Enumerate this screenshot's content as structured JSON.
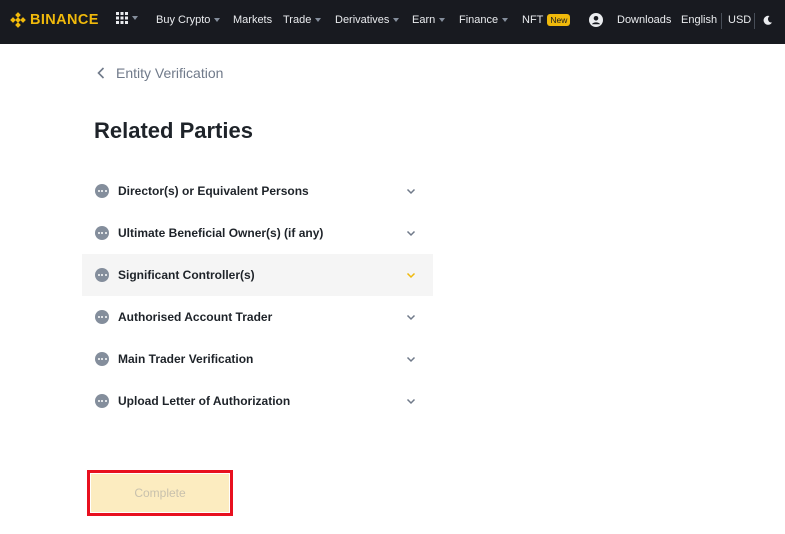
{
  "brand": {
    "name": "BINANCE",
    "color": "#f0b90b"
  },
  "nav": {
    "items": [
      {
        "label": "Buy Crypto",
        "caret": true
      },
      {
        "label": "Markets",
        "caret": false
      },
      {
        "label": "Trade",
        "caret": true
      },
      {
        "label": "Derivatives",
        "caret": true
      },
      {
        "label": "Earn",
        "caret": true
      },
      {
        "label": "Finance",
        "caret": true
      },
      {
        "label": "NFT",
        "badge": "New"
      }
    ],
    "right": {
      "downloads": "Downloads",
      "language": "English",
      "currency": "USD",
      "icons": [
        "grid-apps-icon",
        "user-avatar-icon",
        "dark-mode-moon-icon"
      ]
    }
  },
  "page": {
    "back_label": "Entity Verification",
    "title": "Related Parties",
    "sections": [
      {
        "label": "Director(s) or Equivalent Persons",
        "active": false
      },
      {
        "label": "Ultimate Beneficial Owner(s) (if any)",
        "active": false
      },
      {
        "label": "Significant Controller(s)",
        "active": true
      },
      {
        "label": "Authorised Account Trader",
        "active": false
      },
      {
        "label": "Main Trader Verification",
        "active": false
      },
      {
        "label": "Upload Letter of Authorization",
        "active": false
      }
    ],
    "complete_label": "Complete"
  },
  "colors": {
    "accent": "#f0b90b",
    "highlight_outline": "#e8101f",
    "button_disabled_bg": "#fcecc0"
  }
}
